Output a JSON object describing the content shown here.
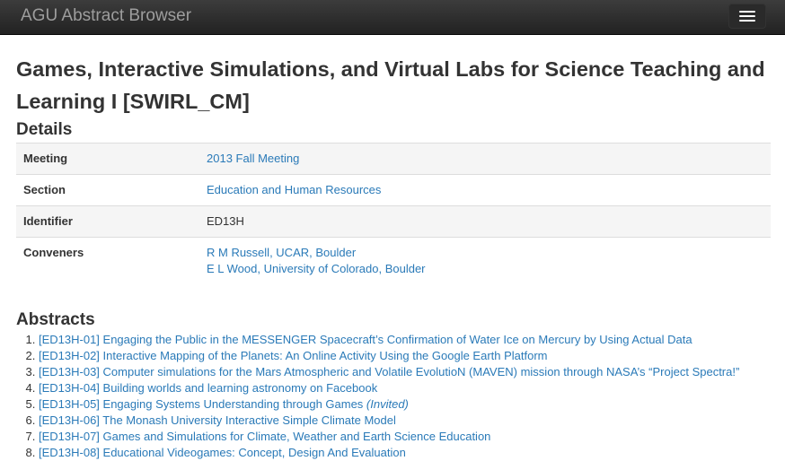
{
  "app": {
    "brand": "AGU Abstract Browser",
    "menu_icon": "hamburger-menu-icon"
  },
  "page": {
    "title": "Games, Interactive Simulations, and Virtual Labs for Science Teaching and Learning I [SWIRL_CM]"
  },
  "details": {
    "heading": "Details",
    "rows": [
      {
        "label": "Meeting",
        "value": "2013 Fall Meeting"
      },
      {
        "label": "Section",
        "value": "Education and Human Resources"
      },
      {
        "label": "Identifier",
        "value": "ED13H"
      },
      {
        "label": "Conveners",
        "values": [
          "R M Russell, UCAR, Boulder",
          "E L Wood, University of Colorado, Boulder"
        ]
      }
    ]
  },
  "abstracts": {
    "heading": "Abstracts",
    "items": [
      {
        "text": "[ED13H-01] Engaging the Public in the MESSENGER Spacecraft’s Confirmation of Water Ice on Mercury by Using Actual Data",
        "note": ""
      },
      {
        "text": "[ED13H-02] Interactive Mapping of the Planets: An Online Activity Using the Google Earth Platform",
        "note": ""
      },
      {
        "text": "[ED13H-03] Computer simulations for the Mars Atmospheric and Volatile EvolutioN (MAVEN) mission through NASA’s “Project Spectra!”",
        "note": ""
      },
      {
        "text": "[ED13H-04] Building worlds and learning astronomy on Facebook",
        "note": ""
      },
      {
        "text": "[ED13H-05] Engaging Systems Understanding through Games ",
        "note": "(Invited)"
      },
      {
        "text": "[ED13H-06] The Monash University Interactive Simple Climate Model",
        "note": ""
      },
      {
        "text": "[ED13H-07] Games and Simulations for Climate, Weather and Earth Science Education",
        "note": ""
      },
      {
        "text": "[ED13H-08] Educational Videogames: Concept, Design And Evaluation",
        "note": ""
      }
    ]
  },
  "colors": {
    "navbar_bg": "#222222",
    "brand_text": "#9d9d9d",
    "link": "#2a7ab8",
    "stripe": "#f5f5f5",
    "border": "#dddddd"
  }
}
